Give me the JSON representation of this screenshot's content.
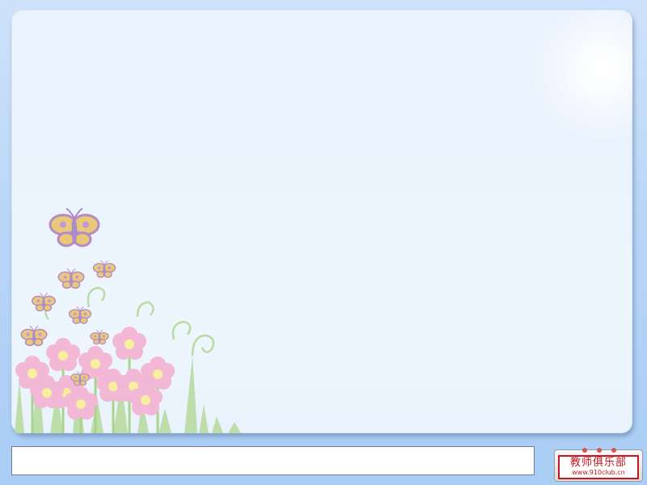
{
  "slide": {
    "bottom_text": ""
  },
  "logo": {
    "title": "教师俱乐部",
    "url": "www.910club.cn"
  },
  "colors": {
    "page_background": "#b9d6f7",
    "panel_background": "#ebf3fd",
    "petal_pink": "#f2b8d6",
    "flower_center": "#f7ee9e",
    "butterfly_wing": "#e9c87a",
    "butterfly_body": "#a98cc9",
    "grass_green": "#b9dca2",
    "logo_red": "#c8161d"
  },
  "decorations": {
    "illustration": "flower-garden-illustration",
    "butterfly": "butterfly-icon",
    "flower": "flower-icon",
    "sun": "sun-glow"
  }
}
